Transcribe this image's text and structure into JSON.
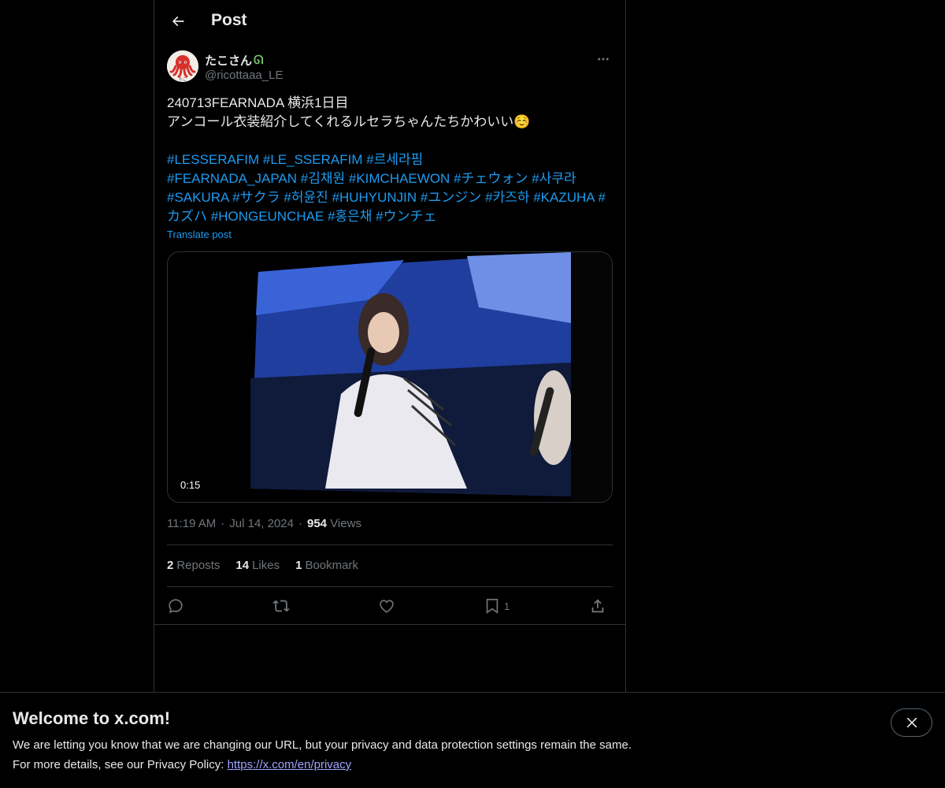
{
  "header": {
    "title": "Post",
    "back_icon": "arrow-left-icon"
  },
  "author": {
    "display_name": "たこさん",
    "name_emoji": "ᘏ",
    "handle": "@ricottaaa_LE",
    "avatar_text": "たこ"
  },
  "post": {
    "line1": "240713FEARNADA 横浜1日目",
    "line2": "アンコール衣装紹介してくれるルセラちゃんたちかわいい☺️",
    "hashtags": [
      "#LESSERAFIM",
      "#LE_SSERAFIM",
      "#르세라핌",
      "#FEARNADA_JAPAN",
      "#김채원",
      "#KIMCHAEWON",
      "#チェウォン",
      "#사쿠라",
      "#SAKURA",
      "#サクラ",
      "#허윤진",
      "#HUHYUNJIN",
      "#ユンジン",
      "#카즈하",
      "#KAZUHA",
      "#カズハ",
      "#HONGEUNCHAE",
      "#홍은채",
      "#ウンチェ"
    ],
    "translate_label": "Translate post",
    "video_duration": "0:15"
  },
  "meta": {
    "time": "11:19 AM",
    "separator": "·",
    "date": "Jul 14, 2024",
    "views_count": "954",
    "views_label": "Views"
  },
  "stats": {
    "reposts_count": "2",
    "reposts_label": "Reposts",
    "likes_count": "14",
    "likes_label": "Likes",
    "bookmarks_count": "1",
    "bookmarks_label": "Bookmark"
  },
  "actions": {
    "bookmark_count": "1"
  },
  "banner": {
    "title": "Welcome to x.com!",
    "line1": "We are letting you know that we are changing our URL, but your privacy and data protection settings remain the same.",
    "line2_prefix": "For more details, see our Privacy Policy: ",
    "link": "https://x.com/en/privacy"
  },
  "colors": {
    "accent": "#1d9bf0",
    "background": "#000000",
    "text": "#e7e9ea",
    "muted": "#71767b",
    "border": "#2f3336"
  }
}
